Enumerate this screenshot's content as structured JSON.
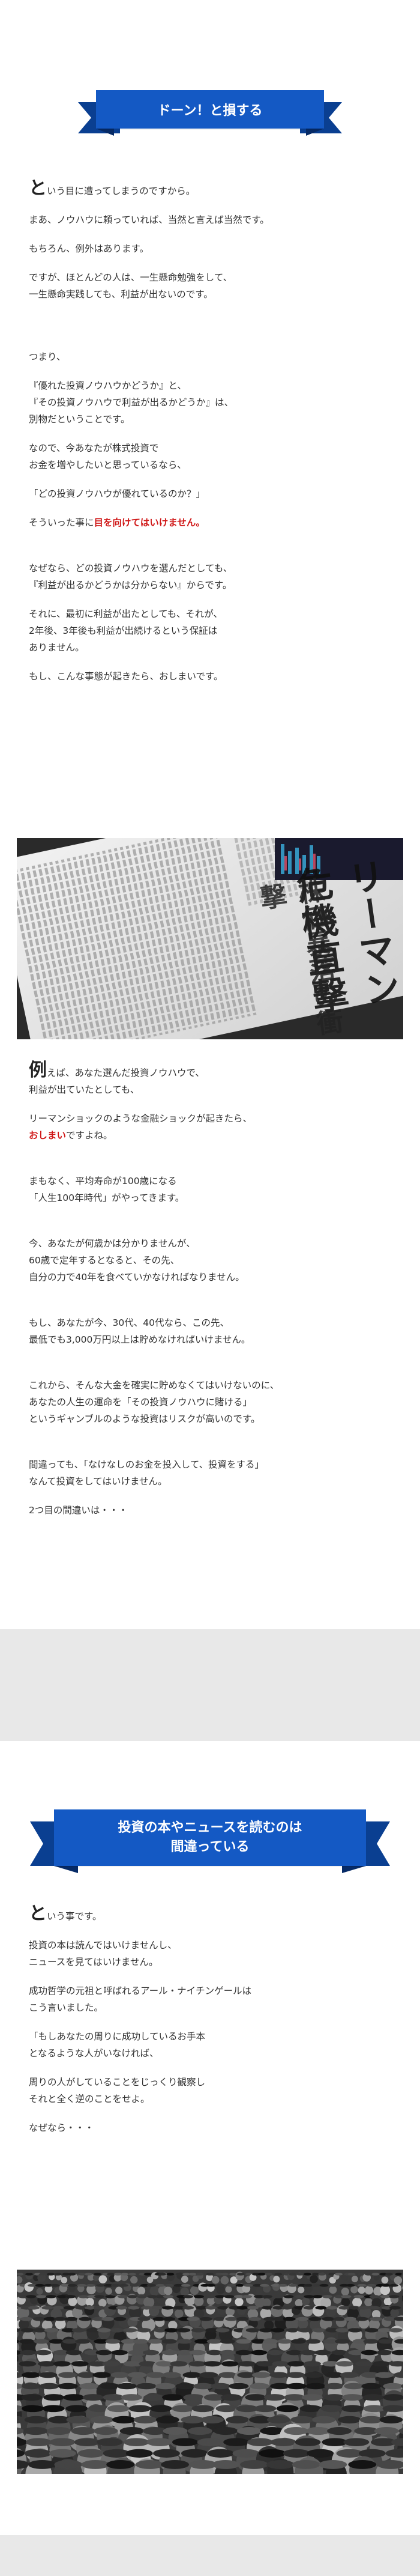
{
  "section1": {
    "banner": "ドーン！と損する",
    "intro_big": "と",
    "intro_rest": "いう目に遭ってしまうのですから。",
    "paragraphs": [
      "まあ、ノウハウに頼っていれば、当然と言えば当然です。",
      "もちろん、例外はあります。",
      "ですが、ほとんどの人は、一生懸命勉強をして、\n一生懸命実践しても、利益が出ないのです。",
      "つまり、",
      "『優れた投資ノウハウかどうか』と、\n『その投資ノウハウで利益が出るかどうか』は、\n別物だということです。",
      "なので、今あなたが株式投資で\nお金を増やしたいと思っているなら、",
      "「どの投資ノウハウが優れているのか？」"
    ],
    "warn_pre": "そういった事に",
    "warn_red": "目を向けてはいけません。",
    "paragraphs2": [
      "なぜなら、どの投資ノウハウを選んだとしても、\n『利益が出るかどうかは分からない』からです。",
      "それに、最初に利益が出たとしても、それが、\n2年後、3年後も利益が出続けるという保証は\nありません。",
      "もし、こんな事態が起きたら、おしまいです。"
    ],
    "newspaper_headline": "リーマン危機直撃",
    "newspaper_sub": "株価暴落の衝撃"
  },
  "section2": {
    "ex_big": "例",
    "ex_rest": "えば、あなた選んだ投資ノウハウで、\n利益が出ていたとしても、",
    "lehman": "リーマンショックのような金融ショックが起きたら、",
    "lehman_red": "おしまい",
    "lehman_tail": "ですよね。",
    "paragraphs": [
      "まもなく、平均寿命が100歳になる\n「人生100年時代」がやってきます。",
      "今、あなたが何歳かは分かりませんが、\n60歳で定年するとなると、その先、\n自分の力で40年を食べていかなければなりません。",
      "もし、あなたが今、30代、40代なら、この先、\n最低でも3,000万円以上は貯めなければいけません。",
      "これから、そんな大金を確実に貯めなくてはいけないのに、\nあなたの人生の運命を「その投資ノウハウに賭ける」\nというギャンブルのような投資はリスクが高いのです。",
      "間違っても、「なけなしのお金を投入して、投資をする」\nなんて投資をしてはいけません。",
      "2つ目の間違いは・・・"
    ]
  },
  "section3": {
    "banner_line1": "投資の本やニュースを読むのは",
    "banner_line2": "間違っている",
    "intro_big": "と",
    "intro_rest": "いう事です。",
    "paragraphs": [
      "投資の本は読んではいけませんし、\nニュースを見てはいけません。",
      "成功哲学の元祖と呼ばれるアール・ナイチンゲールは\nこう言いました。",
      "「もしあなたの周りに成功しているお手本\nとなるような人がいなければ、",
      "周りの人がしていることをじっくり観察し\nそれと全く逆のことをせよ。",
      "なぜなら・・・"
    ]
  },
  "colors": {
    "banner": "#1459c4",
    "banner_dark": "#0a3f91",
    "accent_red": "#d01919",
    "band": "#e8e8e8"
  }
}
